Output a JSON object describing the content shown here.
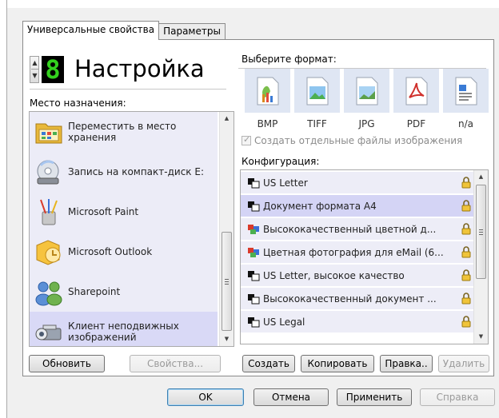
{
  "tabs": [
    "Универсальные свойства",
    "Параметры"
  ],
  "header": {
    "digit": "8",
    "title": "Настройка"
  },
  "destination": {
    "label": "Место назначения:",
    "items": [
      {
        "label": "Переместить в место хранения",
        "icon": "folder-storage-icon"
      },
      {
        "label": "Запись на компакт-диск E:",
        "icon": "cd-burn-icon"
      },
      {
        "label": "Microsoft Paint",
        "icon": "paint-icon"
      },
      {
        "label": "Microsoft Outlook",
        "icon": "outlook-icon"
      },
      {
        "label": "Sharepoint",
        "icon": "sharepoint-icon"
      },
      {
        "label": "Клиент неподвижных изображений",
        "icon": "still-image-client-icon"
      }
    ],
    "selected_index": 5,
    "refresh_button": "Обновить",
    "properties_button": "Свойства..."
  },
  "format": {
    "label": "Выберите формат:",
    "items": [
      {
        "label": "BMP",
        "icon": "bmp-file-icon"
      },
      {
        "label": "TIFF",
        "icon": "tiff-file-icon"
      },
      {
        "label": "JPG",
        "icon": "jpg-file-icon"
      },
      {
        "label": "PDF",
        "icon": "pdf-file-icon"
      },
      {
        "label": "n/a",
        "icon": "na-file-icon"
      }
    ],
    "separate_files_label": "Создать отдельные файлы изображения",
    "separate_files_checked": true
  },
  "configuration": {
    "label": "Конфигурация:",
    "items": [
      {
        "label": "US Letter",
        "icon": "bw-config-icon"
      },
      {
        "label": "Документ формата A4",
        "icon": "bw-config-icon"
      },
      {
        "label": "Высококачественный цветной д...",
        "icon": "color-config-icon"
      },
      {
        "label": "Цветная фотография для eMail (6...",
        "icon": "color-config-icon"
      },
      {
        "label": "US Letter, высокое качество",
        "icon": "bw-config-icon"
      },
      {
        "label": "Высококачественный документ ...",
        "icon": "bw-config-icon"
      },
      {
        "label": "US Legal",
        "icon": "bw-config-icon"
      }
    ],
    "selected_index": 1,
    "create_button": "Создать",
    "copy_button": "Копировать",
    "edit_button": "Правка..",
    "delete_button": "Удалить"
  },
  "footer": {
    "ok_button": "OK",
    "cancel_button": "Отмена",
    "apply_button": "Применить",
    "help_button": "Справка"
  },
  "colors": {
    "list_item_bg": "#ececf7",
    "list_item_selected_bg": "#d9d9f6",
    "format_tile_bg": "#dfe6f3",
    "segment_digit": "#33d11e"
  }
}
